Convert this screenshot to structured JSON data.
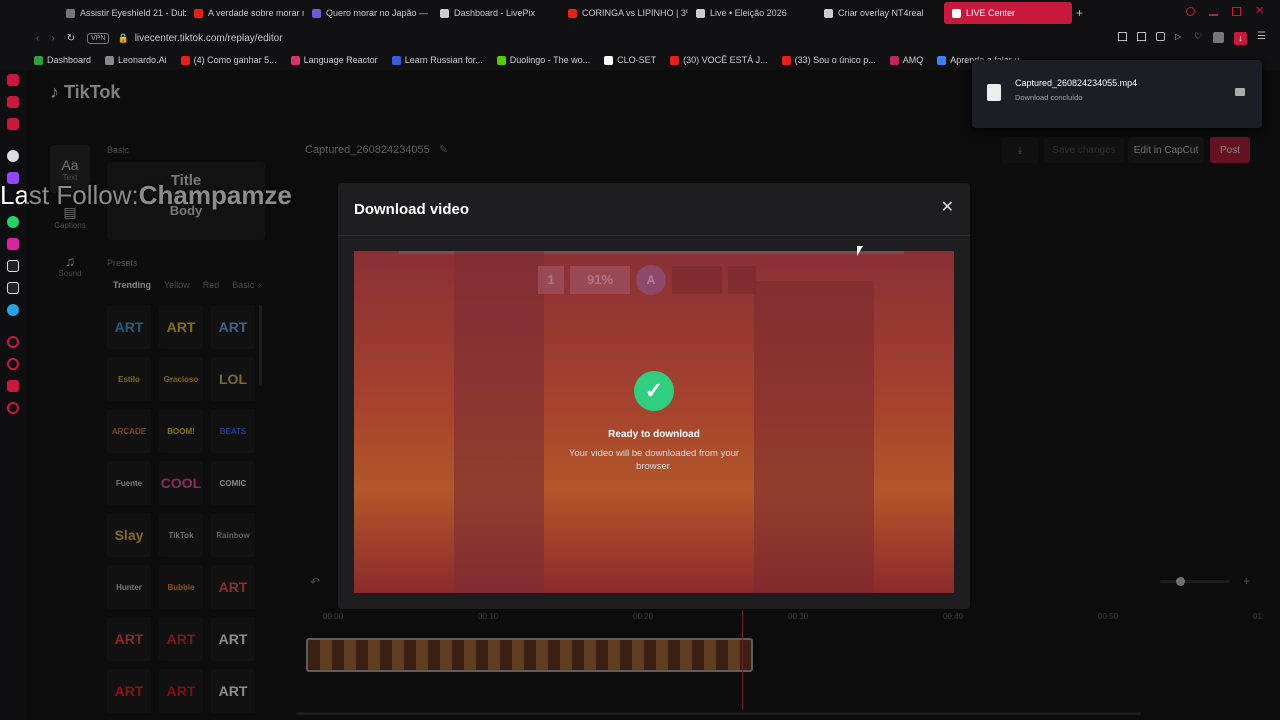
{
  "browser": {
    "tabs": [
      {
        "label": "Assistir Eyeshield 21 - Dub",
        "color": "#777777"
      },
      {
        "label": "A verdade sobre morar no",
        "color": "#e62117"
      },
      {
        "label": "Quero morar no Japão — ",
        "color": "#6b5bd6"
      },
      {
        "label": "Dashboard - LivePix",
        "color": "#cccccc"
      },
      {
        "label": "CORINGA vs LIPINHO | 3º",
        "color": "#e62117"
      },
      {
        "label": "Live • Eleição 2026",
        "color": "#cccccc"
      },
      {
        "label": "Criar overlay NT4real",
        "color": "#cccccc"
      },
      {
        "label": "LIVE Center",
        "color": "#ffffff",
        "active": true
      }
    ],
    "new_tab": "+",
    "url": "livecenter.tiktok.com/replay/editor",
    "vpn_label": "VPN",
    "bookmarks": [
      {
        "label": "Dashboard",
        "color": "#2ea043"
      },
      {
        "label": "Leonardo.Ai",
        "color": "#888888"
      },
      {
        "label": "(4) Como ganhar 5...",
        "color": "#e62117"
      },
      {
        "label": "Language Reactor",
        "color": "#d6336c"
      },
      {
        "label": "Learn Russian for...",
        "color": "#3b5bdb"
      },
      {
        "label": "Duolingo - The wo...",
        "color": "#58cc02"
      },
      {
        "label": "CLO-SET",
        "color": "#ffffff"
      },
      {
        "label": "(30) VOCÊ ESTÁ J...",
        "color": "#e62117"
      },
      {
        "label": "(33) Sou o único p...",
        "color": "#e62117"
      },
      {
        "label": "AMQ",
        "color": "#c2255c"
      },
      {
        "label": "Aprenda a falar u...",
        "color": "#3b82f6"
      }
    ]
  },
  "download_popup": {
    "filename": "Captured_260824234055.mp4",
    "status": "Download concluído"
  },
  "app": {
    "logo": "TikTok",
    "rail": [
      {
        "label": "Text",
        "glyph": "Aa"
      },
      {
        "label": "Captions",
        "glyph": "▤"
      },
      {
        "label": "Sound",
        "glyph": "♫"
      }
    ],
    "basic_label": "Basic",
    "title_card": {
      "title": "Title",
      "body": "Body"
    },
    "presets_label": "Presets",
    "preset_tabs": [
      "Trending",
      "Yellow",
      "Red",
      "Basic"
    ],
    "preset_items": [
      {
        "label": "ART",
        "color": "#3fa9f5"
      },
      {
        "label": "ART",
        "color": "#f5c518"
      },
      {
        "label": "ART",
        "color": "#6fb7ff"
      },
      {
        "label": "Estilo",
        "color": "#f5c518"
      },
      {
        "label": "Gracioso",
        "color": "#e6b422"
      },
      {
        "label": "LOL",
        "color": "#d9c45a"
      },
      {
        "label": "ARCADE",
        "color": "#e08030"
      },
      {
        "label": "BOOM!",
        "color": "#f0d020"
      },
      {
        "label": "BEATS",
        "color": "#3f6fff"
      },
      {
        "label": "Fuente",
        "color": "#dddddd"
      },
      {
        "label": "COOL",
        "color": "#ff4fa0"
      },
      {
        "label": "COMIC",
        "color": "#f0f0f0"
      },
      {
        "label": "Slay",
        "color": "#f0c040"
      },
      {
        "label": "TikTok",
        "color": "#cccccc"
      },
      {
        "label": "Rainbow",
        "color": "#aaaaaa"
      },
      {
        "label": "Hunter",
        "color": "#dddddd"
      },
      {
        "label": "Bubble",
        "color": "#ff8c2a"
      },
      {
        "label": "ART",
        "color": "#ff5050"
      },
      {
        "label": "ART",
        "color": "#ff4a4a"
      },
      {
        "label": "ART",
        "color": "#e03030"
      },
      {
        "label": "ART",
        "color": "#ffffff"
      },
      {
        "label": "ART",
        "color": "#ff2020"
      },
      {
        "label": "ART",
        "color": "#e02020"
      },
      {
        "label": "ART",
        "color": "#ffffff"
      }
    ],
    "project_name": "Captured_260824234055",
    "save_changes": "Save changes",
    "edit_in_capcut": "Edit in CapCut",
    "post": "Post",
    "timeline_marks": [
      "00:00",
      "00:10",
      "00:20",
      "00:30",
      "00:40",
      "00:50",
      "01:"
    ]
  },
  "overlay": {
    "prefix": "Last Follow:",
    "name": "Champamze"
  },
  "modal": {
    "title": "Download video",
    "close": "✕",
    "hud_left": "1",
    "hud_pct": "91%",
    "hud_letter": "A",
    "ready_title": "Ready to download",
    "ready_text": "Your video will be downloaded from your browser."
  }
}
